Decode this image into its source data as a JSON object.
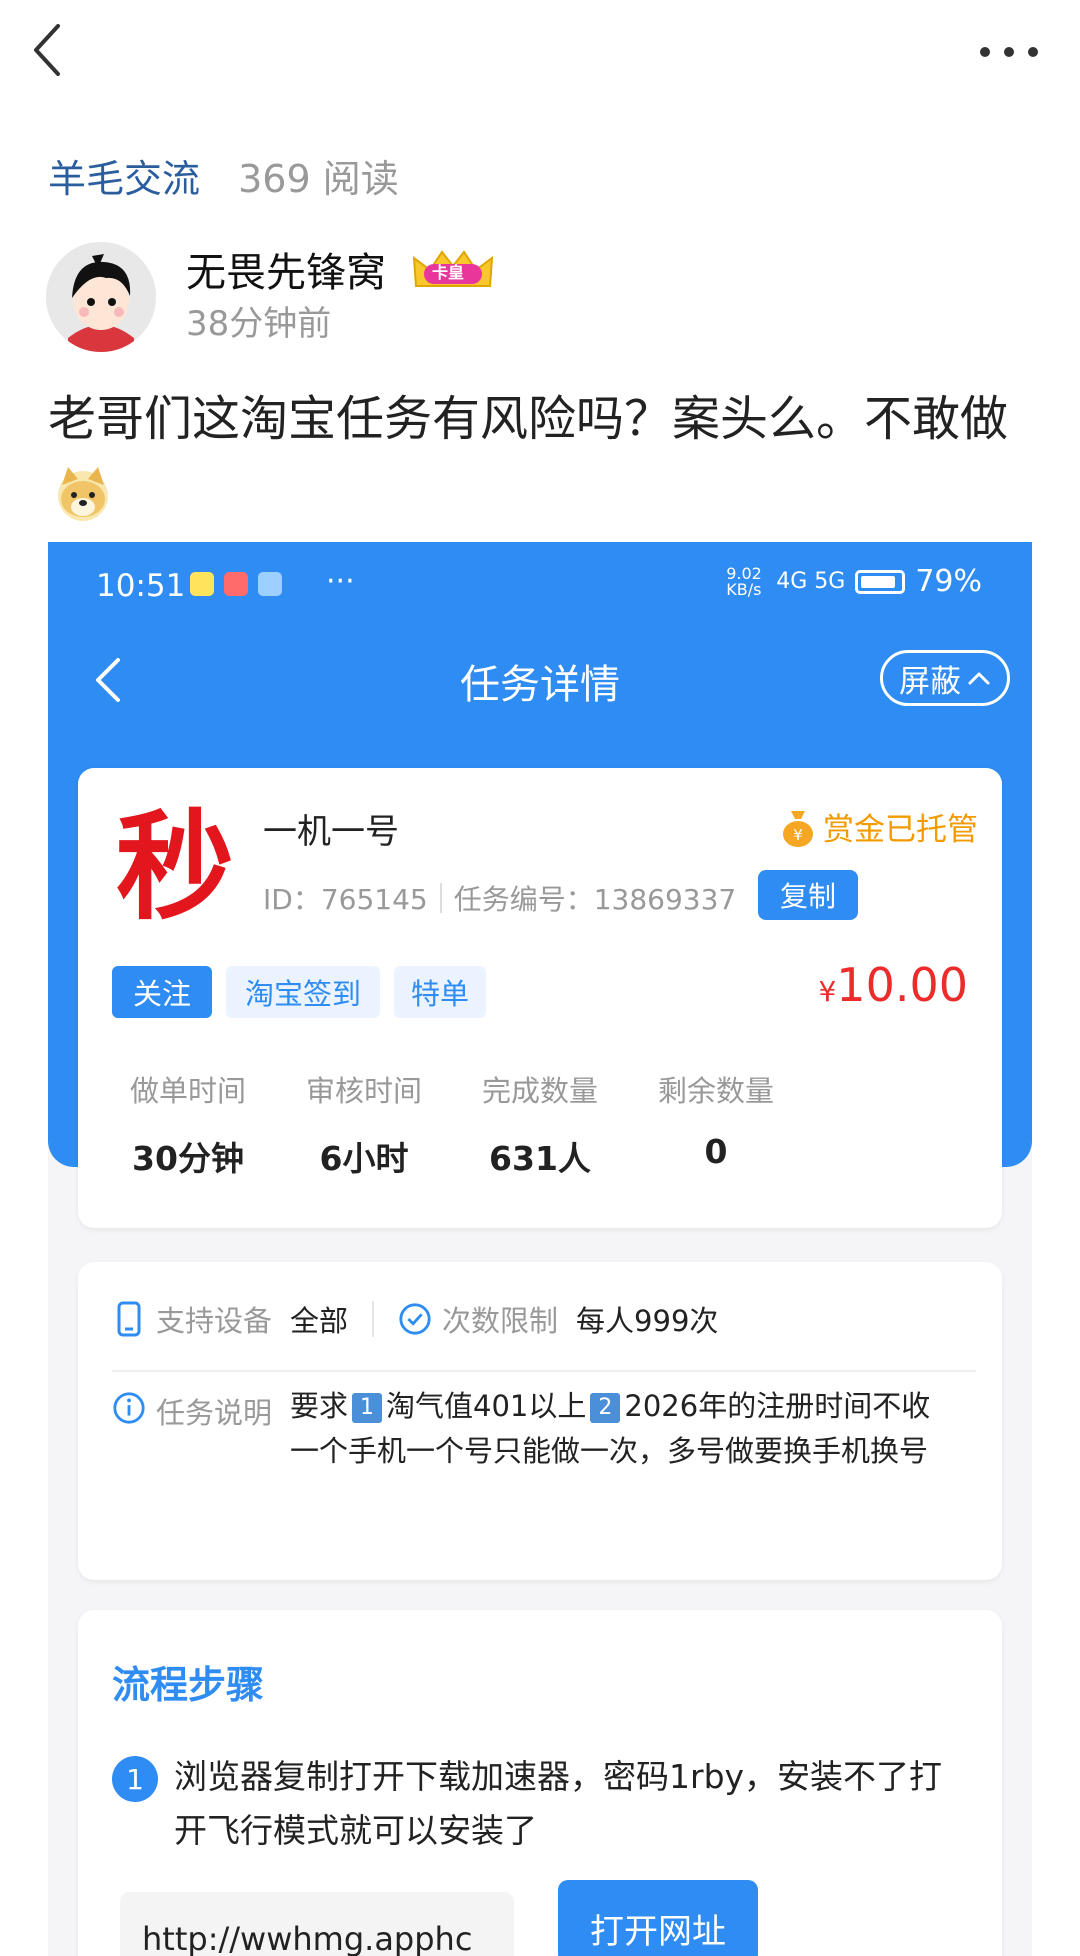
{
  "header": {
    "circle": "羊毛交流",
    "reads": "369 阅读"
  },
  "author": {
    "name": "无畏先锋窝",
    "badge": "卡皇",
    "time": "38分钟前"
  },
  "post": {
    "text": "老哥们这淘宝任务有风险吗？案头么。不敢做"
  },
  "screenshot": {
    "status": {
      "time": "10:51",
      "speed": "9.02 KB/s",
      "network": "4G 5G",
      "battery": "79%"
    },
    "page_title": "任务详情",
    "shield_label": "屏蔽",
    "task": {
      "badge": "秒",
      "name": "一机一号",
      "id": "ID：765145",
      "task_no": "任务编号：13869337",
      "copy": "复制",
      "escrow": "赏金已托管",
      "tags": [
        "关注",
        "淘宝签到",
        "特单"
      ],
      "price_symbol": "¥",
      "price": "10.00",
      "stats": [
        {
          "label": "做单时间",
          "value": "30分钟"
        },
        {
          "label": "审核时间",
          "value": "6小时"
        },
        {
          "label": "完成数量",
          "value": "631人"
        },
        {
          "label": "剩余数量",
          "value": "0"
        }
      ]
    },
    "info": {
      "device_label": "支持设备",
      "device_value": "全部",
      "limit_label": "次数限制",
      "limit_value": "每人999次",
      "desc_label": "任务说明",
      "desc_prefix": "要求",
      "desc_n1": "1",
      "desc_part1": "淘气值401以上",
      "desc_n2": "2",
      "desc_part2": "2026年的注册时间不收 一个手机一个号只能做一次，多号做要换手机换号"
    },
    "flow": {
      "title": "流程步骤",
      "step1_num": "1",
      "step1_text": "浏览器复制打开下载加速器，密码1rby，安装不了打开飞行模式就可以安装了",
      "url": "http://wwhmg.apphc",
      "open_button": "打开网址"
    }
  },
  "colors": {
    "accent": "#2f8cf2",
    "price": "#ee2b2b",
    "escrow": "#f29a00",
    "circle_link": "#2a5d9e"
  }
}
